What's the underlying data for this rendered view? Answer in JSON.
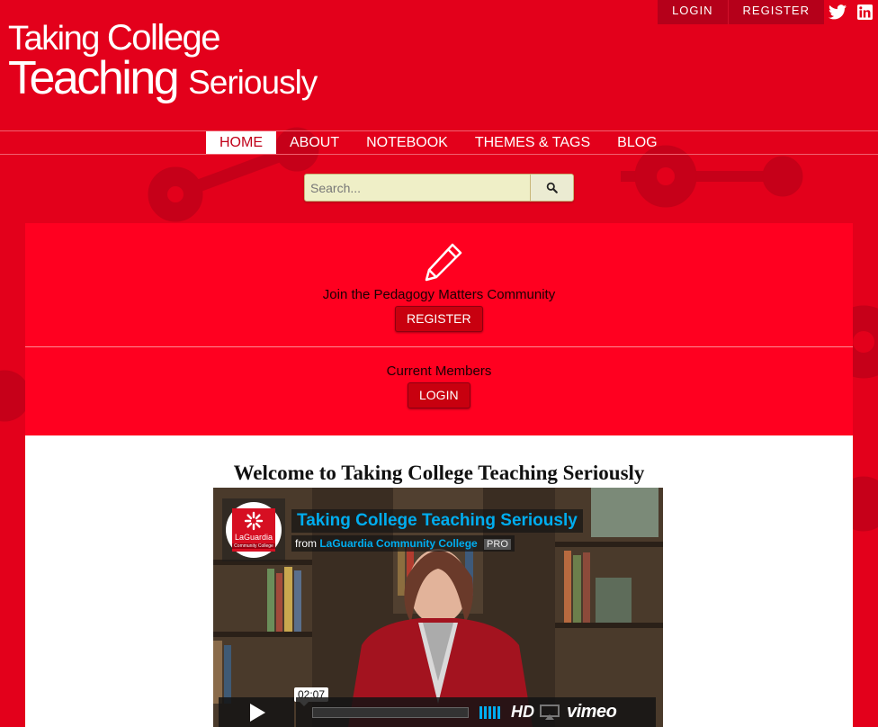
{
  "brand": {
    "line1_a": "Taking",
    "line1_b": "College",
    "line2_a": "Teaching",
    "line2_b": "Seriously"
  },
  "topbar": {
    "login": "LOGIN",
    "register": "REGISTER",
    "icons": [
      "twitter-icon",
      "linkedin-icon"
    ]
  },
  "nav": {
    "items": [
      {
        "label": "HOME",
        "active": true
      },
      {
        "label": "ABOUT"
      },
      {
        "label": "NOTEBOOK"
      },
      {
        "label": "THEMES & TAGS"
      },
      {
        "label": "BLOG"
      }
    ]
  },
  "search": {
    "placeholder": "Search...",
    "icon": "search-icon"
  },
  "community": {
    "icon": "pencil-icon",
    "join_text": "Join the Pedagogy Matters Community",
    "register_label": "REGISTER",
    "members_text": "Current Members",
    "login_label": "LOGIN"
  },
  "main": {
    "welcome": "Welcome to Taking College Teaching Seriously"
  },
  "video": {
    "title": "Taking College Teaching Seriously",
    "from_prefix": "from",
    "channel": "LaGuardia Community College",
    "badge": "PRO",
    "logo_text": "LaGuardia",
    "logo_sub": "Community College",
    "time": "02:07",
    "hd": "HD",
    "brand": "vimeo"
  },
  "colors": {
    "background": "#e3001b",
    "panel": "#ff0020",
    "button": "#c8000f",
    "video_accent": "#00adef"
  }
}
